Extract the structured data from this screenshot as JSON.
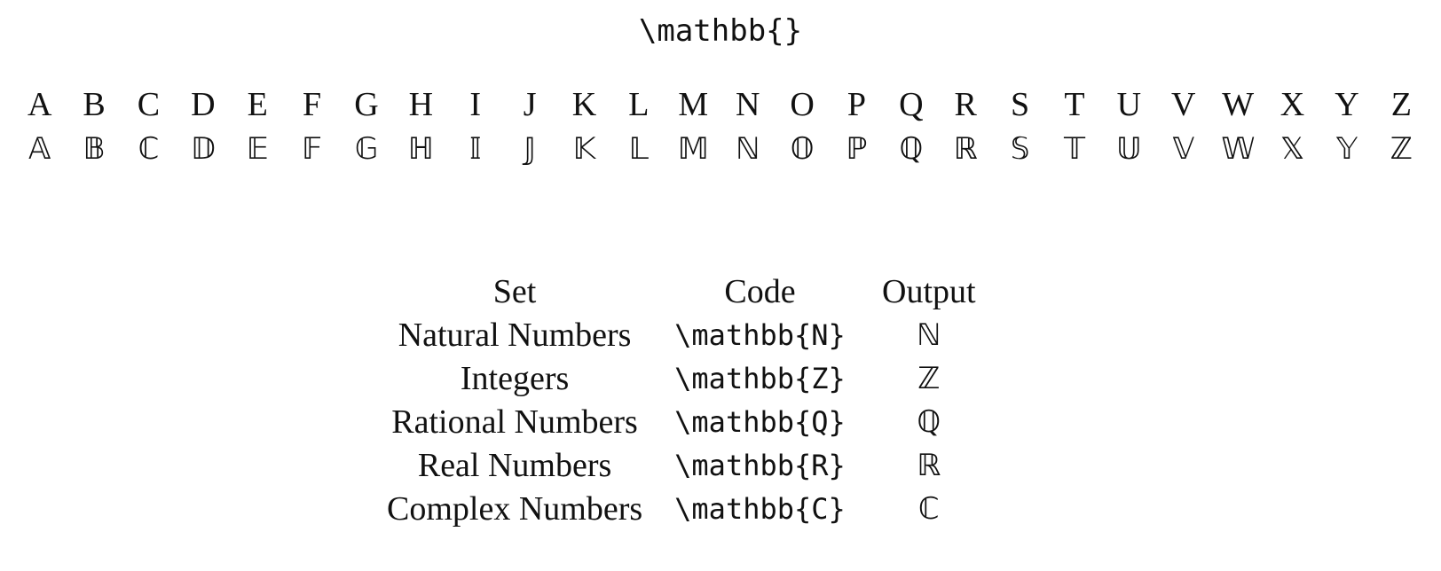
{
  "title": "\\mathbb{}",
  "alphabet": {
    "plain": [
      "A",
      "B",
      "C",
      "D",
      "E",
      "F",
      "G",
      "H",
      "I",
      "J",
      "K",
      "L",
      "M",
      "N",
      "O",
      "P",
      "Q",
      "R",
      "S",
      "T",
      "U",
      "V",
      "W",
      "X",
      "Y",
      "Z"
    ],
    "blackboard": [
      "𝔸",
      "𝔹",
      "ℂ",
      "𝔻",
      "𝔼",
      "𝔽",
      "𝔾",
      "ℍ",
      "𝕀",
      "𝕁",
      "𝕂",
      "𝕃",
      "𝕄",
      "ℕ",
      "𝕆",
      "ℙ",
      "ℚ",
      "ℝ",
      "𝕊",
      "𝕋",
      "𝕌",
      "𝕍",
      "𝕎",
      "𝕏",
      "𝕐",
      "ℤ"
    ]
  },
  "table": {
    "headers": [
      "Set",
      "Code",
      "Output"
    ],
    "rows": [
      {
        "set": "Natural Numbers",
        "code": "\\mathbb{N}",
        "output": "ℕ"
      },
      {
        "set": "Integers",
        "code": "\\mathbb{Z}",
        "output": "ℤ"
      },
      {
        "set": "Rational Numbers",
        "code": "\\mathbb{Q}",
        "output": "ℚ"
      },
      {
        "set": "Real Numbers",
        "code": "\\mathbb{R}",
        "output": "ℝ"
      },
      {
        "set": "Complex Numbers",
        "code": "\\mathbb{C}",
        "output": "ℂ"
      }
    ]
  }
}
